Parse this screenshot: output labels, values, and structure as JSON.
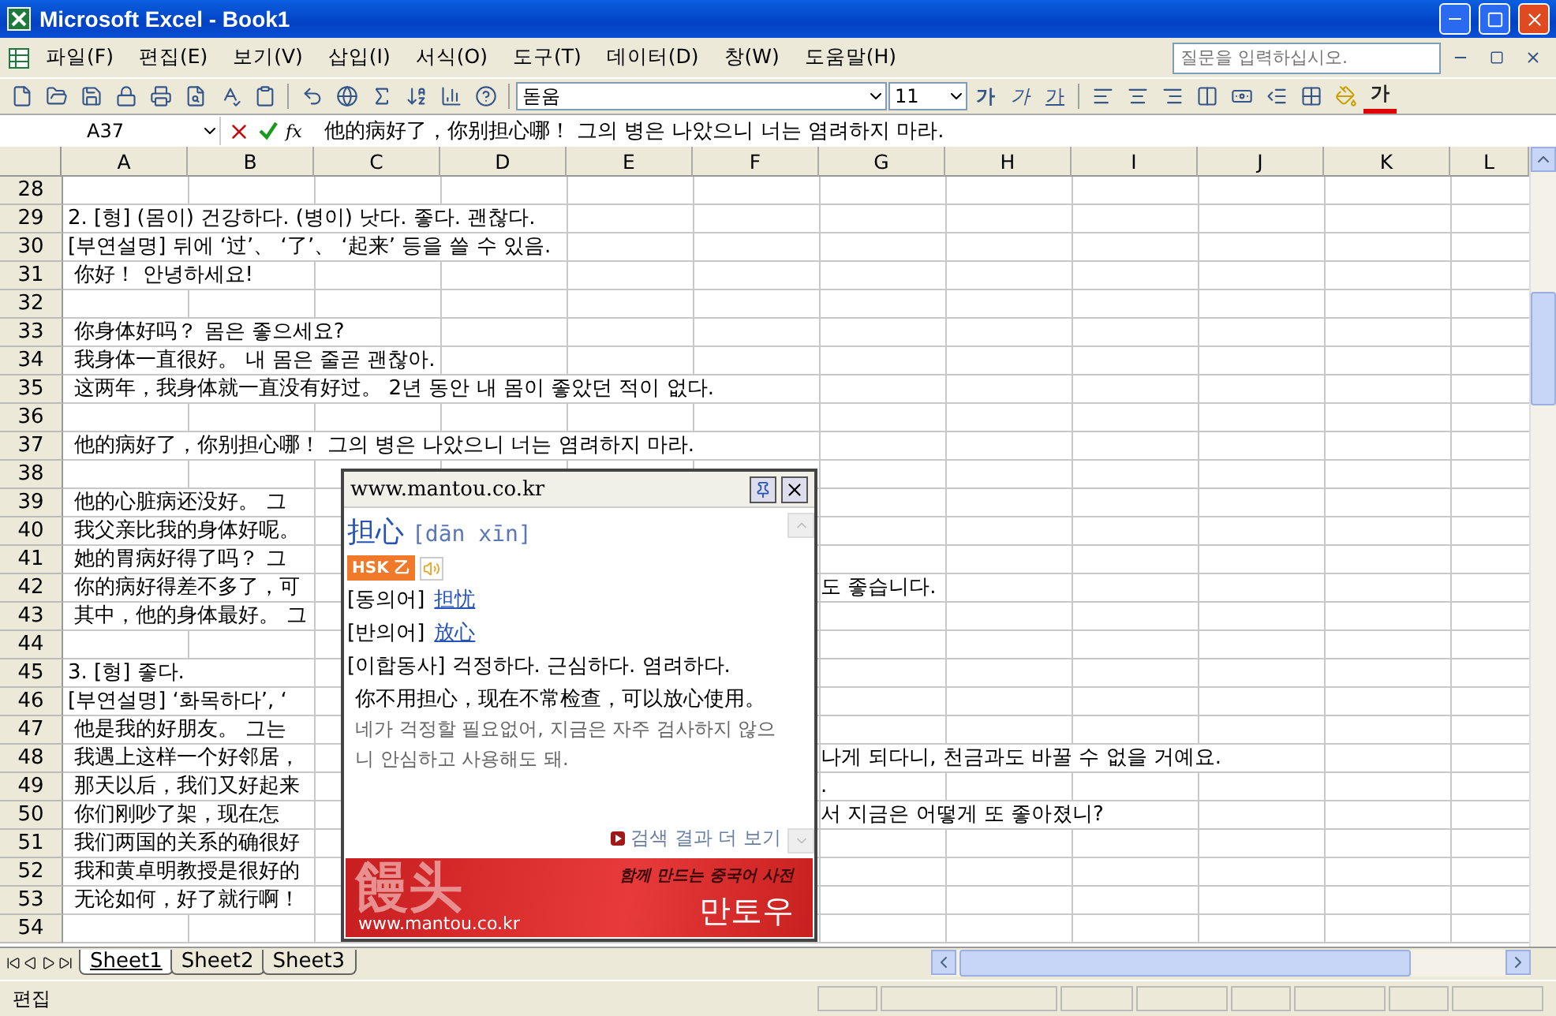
{
  "window": {
    "title": "Microsoft Excel - Book1"
  },
  "menu_bar": {
    "items": [
      "파일(F)",
      "편집(E)",
      "보기(V)",
      "삽입(I)",
      "서식(O)",
      "도구(T)",
      "데이터(D)",
      "창(W)",
      "도움말(H)"
    ],
    "help_search": {
      "placeholder": "질문을 입력하십시오."
    }
  },
  "formatting_toolbar": {
    "font": "돋움",
    "size": "11",
    "bold": "가",
    "italic": "가",
    "underline": "가",
    "font_color": "가"
  },
  "formula_bar": {
    "name_box": "A37",
    "function_label": "fx",
    "content": "他的病好了，你别担心哪！ 그의 병은 나았으니 너는 염려하지 마라."
  },
  "columns": [
    "A",
    "B",
    "C",
    "D",
    "E",
    "F",
    "G",
    "H",
    "I",
    "J",
    "K",
    "L"
  ],
  "rows": [
    {
      "number": "28"
    },
    {
      "number": "29",
      "text": "2. [형] (몸이) 건강하다. (병이) 낫다. 좋다. 괜찮다."
    },
    {
      "number": "30",
      "text": "[부연설명] 뒤에 ‘过’、 ‘了’、 ‘起来’ 등을 쓸 수 있음."
    },
    {
      "number": "31",
      "text": " 你好！ 안녕하세요!"
    },
    {
      "number": "32"
    },
    {
      "number": "33",
      "text": " 你身体好吗？ 몸은 좋으세요?"
    },
    {
      "number": "34",
      "text": " 我身体一直很好。 내 몸은 줄곧 괜찮아."
    },
    {
      "number": "35",
      "text": " 这两年，我身体就一直没有好过。 2년 동안 내 몸이 좋았던 적이 없다."
    },
    {
      "number": "36"
    },
    {
      "number": "37",
      "text": " 他的病好了，你别担心哪！ 그의 병은 나았으니 너는 염려하지 마라."
    },
    {
      "number": "38"
    },
    {
      "number": "39",
      "text": " 他的心脏病还没好。 그"
    },
    {
      "number": "40",
      "text": " 我父亲比我的身体好呢。"
    },
    {
      "number": "41",
      "text": " 她的胃病好得了吗？ 그"
    },
    {
      "number": "42",
      "text": " 你的病好得差不多了，可",
      "text_right": "도 좋습니다."
    },
    {
      "number": "43",
      "text": " 其中，他的身体最好。 그"
    },
    {
      "number": "44"
    },
    {
      "number": "45",
      "text": "3. [형] 좋다."
    },
    {
      "number": "46",
      "text": "[부연설명] ‘화목하다’, ‘"
    },
    {
      "number": "47",
      "text": " 他是我的好朋友。 그는"
    },
    {
      "number": "48",
      "text": " 我遇上这样一个好邻居，",
      "text_right": "나게 되다니, 천금과도 바꿀 수 없을 거예요."
    },
    {
      "number": "49",
      "text": " 那天以后，我们又好起来",
      "text_right": "."
    },
    {
      "number": "50",
      "text": " 你们刚吵了架，现在怎",
      "text_right": "서 지금은 어떻게 또 좋아졌니?"
    },
    {
      "number": "51",
      "text": " 我们两国的关系的确很好"
    },
    {
      "number": "52",
      "text": " 我和黄卓明教授是很好的"
    },
    {
      "number": "53",
      "text": " 无论如何，好了就行啊！"
    },
    {
      "number": "54"
    }
  ],
  "popup": {
    "url": "www.mantou.co.kr",
    "word": "担心",
    "pinyin": "[dān xīn]",
    "badge": "HSK 乙",
    "synonym": {
      "label": "[동의어]",
      "link": "担忧"
    },
    "antonym": {
      "label": "[반의어]",
      "link": "放心"
    },
    "definition": "[이합동사] 걱정하다. 근심하다. 염려하다.",
    "example": {
      "zh": "你不用担心，现在不常检查，可以放心使用。",
      "ko": "네가 걱정할 필요없어, 지금은 자주 검사하지 않으니 안심하고 사용해도 돼."
    },
    "more_link": "검색 결과 더 보기",
    "banner": {
      "logo": "饅头",
      "tagline": "함께 만드는 중국어 사전",
      "brand": "만토우",
      "url": "www.mantou.co.kr"
    }
  },
  "sheet_tabs": [
    {
      "label": "Sheet1",
      "selected": true
    },
    {
      "label": "Sheet2",
      "selected": false
    },
    {
      "label": "Sheet3",
      "selected": false
    }
  ],
  "status_bar": {
    "mode": "편집"
  }
}
